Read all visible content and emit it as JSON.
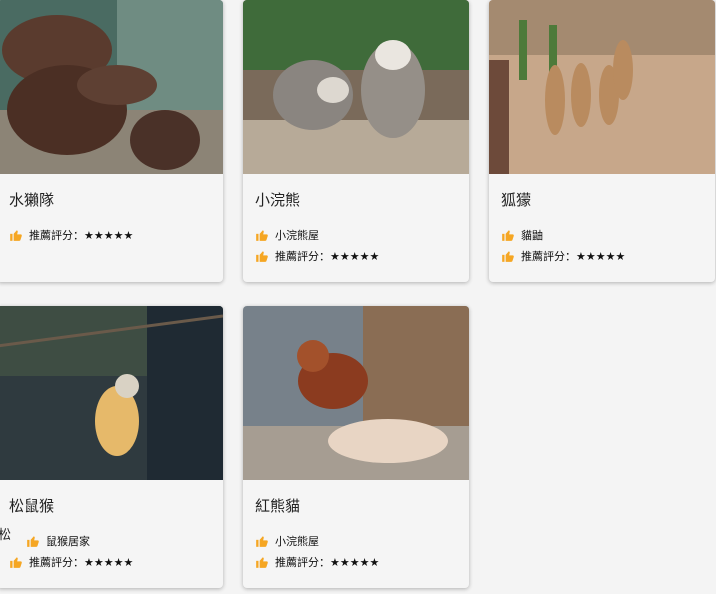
{
  "cards": [
    {
      "title": "水獺隊",
      "location": "",
      "rating_label": "推薦評分：★★★★★"
    },
    {
      "title": "小浣熊",
      "location": "小浣熊屋",
      "rating_label": "推薦評分：★★★★★"
    },
    {
      "title": "狐獴",
      "location": "貓鼬",
      "rating_label": "推薦評分：★★★★★"
    },
    {
      "title": "松鼠猴",
      "location": "鼠猴居家",
      "rating_label": "推薦評分：★★★★★"
    },
    {
      "title": "紅熊貓",
      "location": "小浣熊屋",
      "rating_label": "推薦評分：★★★★★"
    }
  ],
  "stray_text": "松",
  "icons": {
    "row_icon": "thumbs-up-icon"
  },
  "colors": {
    "thumb": "#f5a623",
    "card_bg": "#f5f5f5",
    "page_bg": "#f4f4f4"
  }
}
